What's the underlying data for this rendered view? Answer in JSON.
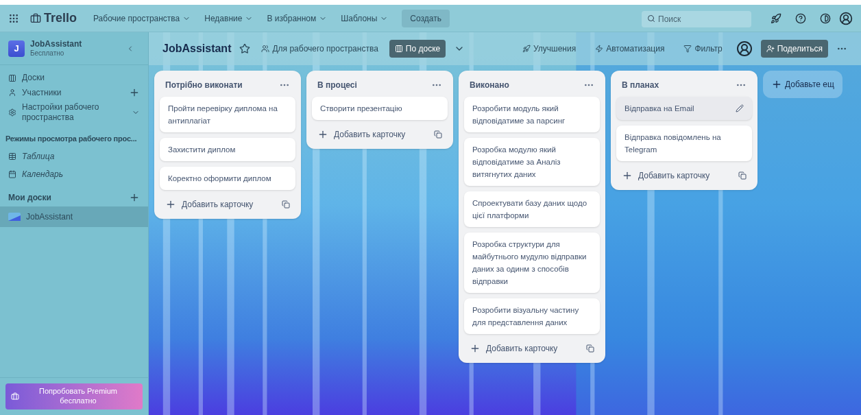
{
  "topbar": {
    "logo": "Trello",
    "menus": [
      {
        "label": "Рабочие пространства"
      },
      {
        "label": "Недавние"
      },
      {
        "label": "В избранном"
      },
      {
        "label": "Шаблоны"
      }
    ],
    "create": "Создать",
    "search": {
      "placeholder": "Поиск"
    }
  },
  "workspace": {
    "initial": "J",
    "name": "JobAssistant",
    "plan": "Бесплатно"
  },
  "sidebar": {
    "items": [
      {
        "label": "Доски",
        "kind": "board",
        "addable": false,
        "expandable": false
      },
      {
        "label": "Участники",
        "kind": "people",
        "addable": true,
        "expandable": false
      },
      {
        "label": "Настройки рабочего пространства",
        "kind": "settings",
        "addable": false,
        "expandable": true
      }
    ],
    "views_heading": "Режимы просмотра рабочего прос...",
    "views": [
      {
        "label": "Таблица",
        "kind": "table"
      },
      {
        "label": "Календарь",
        "kind": "calendar"
      }
    ],
    "boards_heading": "Мои доски",
    "boards": [
      {
        "label": "JobAssistant",
        "selected": true
      }
    ],
    "premium": "Попробовать Premium бесплатно"
  },
  "board_header": {
    "title": "JobAssistant",
    "visibility": "Для рабочего пространства",
    "view": "По доске",
    "actions": [
      {
        "label": "Улучшения",
        "kind": "rocket"
      },
      {
        "label": "Автоматизация",
        "kind": "bolt"
      },
      {
        "label": "Фильтр",
        "kind": "filter"
      }
    ],
    "share": "Поделиться"
  },
  "lists": [
    {
      "title": "Потрібно виконати",
      "cards": [
        {
          "text": "Пройти перевірку диплома на антиплагіат",
          "hovered": false
        },
        {
          "text": "Захистити диплом",
          "hovered": false
        },
        {
          "text": "Коректно оформити диплом",
          "hovered": false
        }
      ],
      "add": "Добавить карточку"
    },
    {
      "title": "В процесі",
      "cards": [
        {
          "text": "Створити презентацію",
          "hovered": false
        }
      ],
      "add": "Добавить карточку"
    },
    {
      "title": "Виконано",
      "cards": [
        {
          "text": "Розробити модуль який відповідатиме за парсинг",
          "hovered": false
        },
        {
          "text": "Розробка модулю який відповідатиме за Аналіз витягнутих даних",
          "hovered": false
        },
        {
          "text": "Спроектувати базу даних щодо цієї платформи",
          "hovered": false
        },
        {
          "text": "Розробка структури для майбутнього мудулю відправки даних за одинм з способів відправки",
          "hovered": false
        },
        {
          "text": "Розробити візуальну частину для представлення даних",
          "hovered": false
        }
      ],
      "add": "Добавить карточку"
    },
    {
      "title": "В планах",
      "cards": [
        {
          "text": "Відправка на Email",
          "hovered": true
        },
        {
          "text": "Відправка повідомлень на Telegram",
          "hovered": false
        }
      ],
      "add": "Добавить карточку"
    }
  ],
  "add_list": "Добавьте ещ"
}
